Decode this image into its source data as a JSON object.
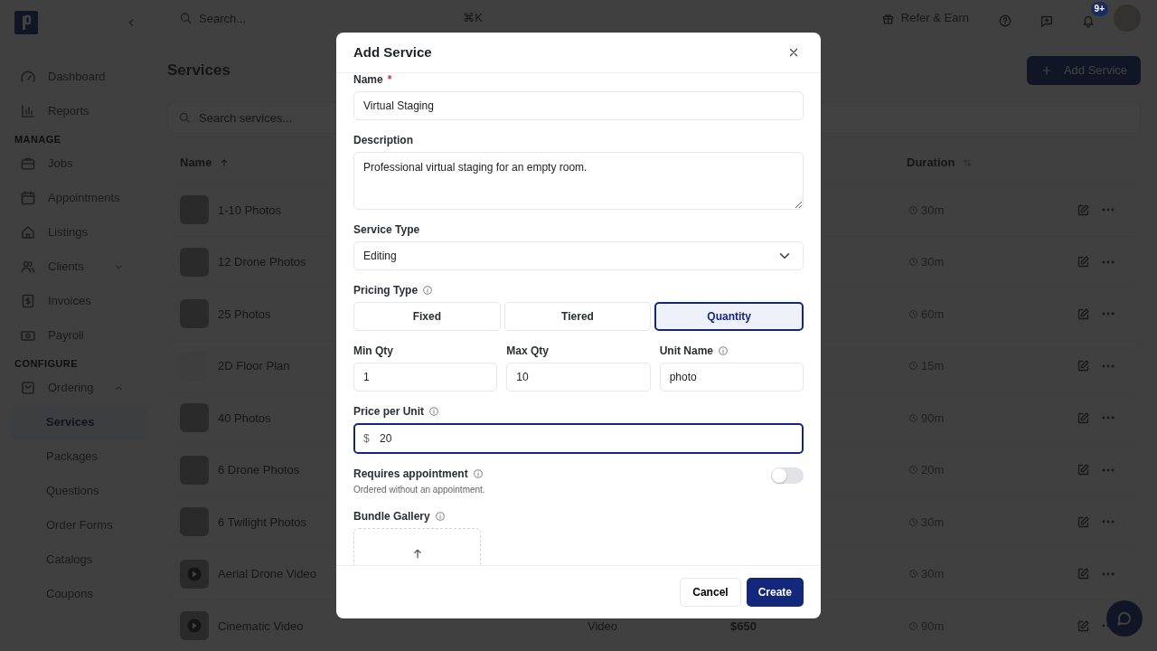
{
  "topbar": {
    "search": {
      "placeholder": "Search...",
      "shortcut": "⌘K"
    },
    "refer_button": "Refer & Earn",
    "notification_badge": "9+"
  },
  "sidebar": {
    "nav": [
      {
        "kind": "item",
        "label": "Dashboard",
        "selected": false
      },
      {
        "kind": "item",
        "label": "Reports",
        "selected": false
      },
      {
        "kind": "section",
        "label": "MANAGE"
      },
      {
        "kind": "item",
        "label": "Jobs",
        "selected": false
      },
      {
        "kind": "item",
        "label": "Appointments",
        "selected": false
      },
      {
        "kind": "item",
        "label": "Listings",
        "selected": false
      },
      {
        "kind": "item",
        "label": "Clients",
        "selected": false,
        "expanded": false
      },
      {
        "kind": "item",
        "label": "Invoices",
        "selected": false
      },
      {
        "kind": "item",
        "label": "Payroll",
        "selected": false
      },
      {
        "kind": "section",
        "label": "CONFIGURE"
      },
      {
        "kind": "item",
        "label": "Ordering",
        "selected": false,
        "expanded": true,
        "children": [
          {
            "label": "Services",
            "selected": true
          },
          {
            "label": "Packages",
            "selected": false
          },
          {
            "label": "Questions",
            "selected": false
          },
          {
            "label": "Order Forms",
            "selected": false
          },
          {
            "label": "Catalogs",
            "selected": false
          },
          {
            "label": "Coupons",
            "selected": false
          }
        ]
      }
    ]
  },
  "page": {
    "title": "Services",
    "add_button": "Add Service",
    "search": {
      "placeholder": "Search services..."
    },
    "table": {
      "columns": [
        {
          "label": "Name",
          "kind": "sorted"
        },
        {
          "label": "Duration",
          "kind": "sortable"
        }
      ],
      "rows": [
        {
          "kind": "photo",
          "name": "1-10 Photos",
          "duration": "30m"
        },
        {
          "kind": "photo",
          "name": "12 Drone Photos",
          "duration": "30m"
        },
        {
          "kind": "photo",
          "name": "25 Photos",
          "duration": "60m"
        },
        {
          "kind": "plan",
          "name": "2D Floor Plan",
          "duration": "15m"
        },
        {
          "kind": "photo",
          "name": "40 Photos",
          "duration": "90m"
        },
        {
          "kind": "photo",
          "name": "6 Drone Photos",
          "duration": "20m"
        },
        {
          "kind": "photo",
          "name": "6 Twilight Photos",
          "duration": "30m"
        },
        {
          "kind": "video",
          "name": "Aerial Drone Video",
          "duration": "30m"
        },
        {
          "kind": "video",
          "name": "Cinematic Video",
          "type": "Video",
          "price": "$650",
          "duration": "90m"
        }
      ]
    }
  },
  "modal": {
    "title": "Add Service",
    "name": {
      "label": "Name",
      "required_mark": "*",
      "value": "Virtual Staging"
    },
    "description": {
      "label": "Description",
      "value": "Professional virtual staging for an empty room."
    },
    "service_type": {
      "label": "Service Type",
      "value": "Editing"
    },
    "pricing_type": {
      "label": "Pricing Type",
      "info": true,
      "options": [
        {
          "label": "Fixed",
          "selected": false
        },
        {
          "label": "Tiered",
          "selected": false
        },
        {
          "label": "Quantity",
          "selected": true
        }
      ]
    },
    "quantity_fields": [
      {
        "label": "Min Qty",
        "value": "1"
      },
      {
        "label": "Max Qty",
        "value": "10"
      },
      {
        "label": "Unit Name",
        "info": true,
        "value": "photo"
      }
    ],
    "price_per_unit": {
      "label": "Price per Unit",
      "info": true,
      "prefix": "$",
      "value": "20",
      "focused": true
    },
    "requires_appointment": {
      "label": "Requires appointment",
      "info": true,
      "hint": "Ordered without an appointment.",
      "on": false
    },
    "bundle_gallery": {
      "label": "Bundle Gallery",
      "info": true
    },
    "buttons": {
      "cancel": "Cancel",
      "create": "Create"
    }
  }
}
